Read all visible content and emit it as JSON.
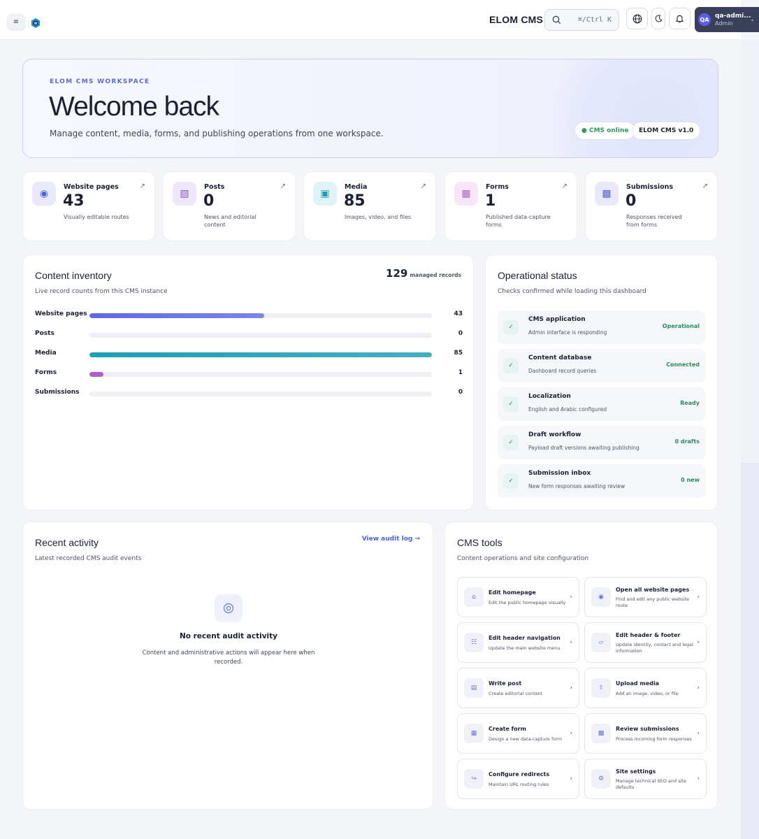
{
  "topbar": {
    "menu_glyph": "≡",
    "brand": "ELOM CMS",
    "search_shortcut": "⌘/Ctrl K",
    "user_initials": "QA",
    "user_name": "qa-admi...",
    "user_role": "Admin"
  },
  "hero": {
    "eyebrow": "ELOM CMS WORKSPACE",
    "title": "Welcome back",
    "subtitle": "Manage content, media, forms, and publishing operations from one workspace.",
    "status_pill": "● CMS online",
    "version_pill": "ELOM CMS v1.0"
  },
  "stats": [
    {
      "label": "Website pages",
      "value": "43",
      "desc": "Visually editable routes",
      "icon": "◉",
      "icon_color": "#4f5fe0",
      "icon_bg": "#e8eafc"
    },
    {
      "label": "Posts",
      "value": "0",
      "desc": "News and editorial content",
      "icon": "▧",
      "icon_color": "#8a5cc9",
      "icon_bg": "#ede7f9"
    },
    {
      "label": "Media",
      "value": "85",
      "desc": "Images, video, and files",
      "icon": "▣",
      "icon_color": "#1a9fb3",
      "icon_bg": "#e0f3f6"
    },
    {
      "label": "Forms",
      "value": "1",
      "desc": "Published data-capture forms",
      "icon": "▦",
      "icon_color": "#b25cc9",
      "icon_bg": "#f6e6f8"
    },
    {
      "label": "Submissions",
      "value": "0",
      "desc": "Responses received from forms",
      "icon": "▩",
      "icon_color": "#5a63d8",
      "icon_bg": "#e8eafc"
    }
  ],
  "inventory": {
    "title": "Content inventory",
    "subtitle": "Live record counts from this CMS instance",
    "total": "129",
    "total_label": "managed records",
    "rows": [
      {
        "label": "Website pages",
        "value": "43",
        "fraction": 0.51,
        "color": "#5b6ce6"
      },
      {
        "label": "Posts",
        "value": "0",
        "fraction": 0,
        "color": "#8a5cc9"
      },
      {
        "label": "Media",
        "value": "85",
        "fraction": 1.0,
        "color": "#1a9fb3"
      },
      {
        "label": "Forms",
        "value": "1",
        "fraction": 0.04,
        "color": "#b25cc9"
      },
      {
        "label": "Submissions",
        "value": "0",
        "fraction": 0,
        "color": "#5a63d8"
      }
    ]
  },
  "operational": {
    "title": "Operational status",
    "subtitle": "Checks confirmed while loading this dashboard",
    "items": [
      {
        "title": "CMS application",
        "desc": "Admin interface is responding",
        "status": "Operational"
      },
      {
        "title": "Content database",
        "desc": "Dashboard record queries",
        "status": "Connected"
      },
      {
        "title": "Localization",
        "desc": "English and Arabic configured",
        "status": "Ready"
      },
      {
        "title": "Draft workflow",
        "desc": "Payload draft versions awaiting publishing",
        "status": "0 drafts"
      },
      {
        "title": "Submission inbox",
        "desc": "New form responses awaiting review",
        "status": "0 new"
      }
    ]
  },
  "activity": {
    "title": "Recent activity",
    "subtitle": "Latest recorded CMS audit events",
    "link": "View audit log →",
    "empty_title": "No recent audit activity",
    "empty_desc": "Content and administrative actions will appear here when recorded."
  },
  "tools": {
    "title": "CMS tools",
    "subtitle": "Content operations and site configuration",
    "items": [
      {
        "title": "Edit homepage",
        "desc": "Edit the public homepage visually",
        "icon": "⌂"
      },
      {
        "title": "Open all website pages",
        "desc": "Find and edit any public website route",
        "icon": "◉"
      },
      {
        "title": "Edit header navigation",
        "desc": "Update the main website menu",
        "icon": "☷"
      },
      {
        "title": "Edit header & footer",
        "desc": "Update identity, contact and legal information",
        "icon": "▱"
      },
      {
        "title": "Write post",
        "desc": "Create editorial content",
        "icon": "▤"
      },
      {
        "title": "Upload media",
        "desc": "Add an image, video, or file",
        "icon": "⇧"
      },
      {
        "title": "Create form",
        "desc": "Design a new data-capture form",
        "icon": "▦"
      },
      {
        "title": "Review submissions",
        "desc": "Process incoming form responses",
        "icon": "▩"
      },
      {
        "title": "Configure redirects",
        "desc": "Maintain URL routing rules",
        "icon": "↪"
      },
      {
        "title": "Site settings",
        "desc": "Manage technical SEO and site defaults",
        "icon": "⚙"
      }
    ]
  }
}
